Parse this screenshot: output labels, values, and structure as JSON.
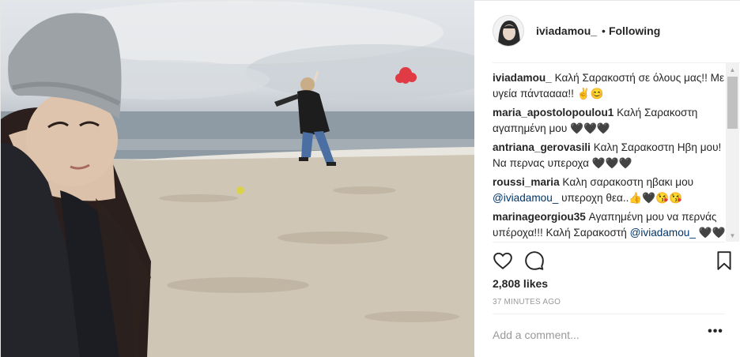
{
  "photo": {
    "alt_icon": "beach-selfie-photo"
  },
  "header": {
    "username": "iviadamou_",
    "separator": "•",
    "follow_status": "Following"
  },
  "comments": [
    {
      "user": "iviadamou_",
      "text": "Καλή Σαρακοστή σε όλους μας!! Με υγεία πάνταααα!! ✌😊"
    },
    {
      "user": "maria_apostolopoulou1",
      "text": "Καλή Σαρακοστη αγαπημένη μου 🖤🖤🖤"
    },
    {
      "user": "antriana_gerovasili",
      "text": "Καλη Σαρακοστη Ηβη μου! Να περνας υπεροχα 🖤🖤🖤"
    },
    {
      "user": "roussi_maria",
      "text": "Καλη σαρακοστη ηβακι μου",
      "mention": "@iviadamou_",
      "text2": "υπεροχη θεα..👍🖤😘😘"
    },
    {
      "user": "marinageorgiou35",
      "text": "Αγαπημένη μου να περνάς υπέροχα!!! Καλή Σαρακοστή",
      "mention": "@iviadamou_",
      "text2": "🖤🖤😘😘"
    }
  ],
  "actions": {
    "like_icon": "heart-icon",
    "comment_icon": "speech-bubble-icon",
    "save_icon": "bookmark-icon"
  },
  "likes": "2,808 likes",
  "timestamp": "37 MINUTES AGO",
  "add_comment": {
    "placeholder": "Add a comment..."
  },
  "more": "•••",
  "scrollbar": {
    "up": "▲",
    "down": "▼"
  }
}
